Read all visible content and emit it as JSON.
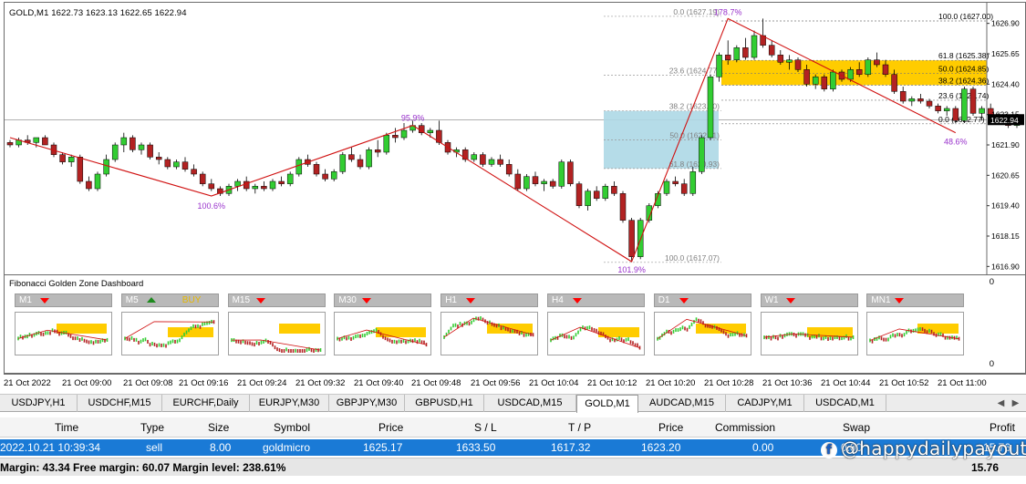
{
  "chart": {
    "title": "GOLD,M1  1622.73 1623.13 1622.65 1622.94",
    "price_tag": "1622.94",
    "price_axis": [
      "1626.90",
      "1625.65",
      "1624.40",
      "1623.15",
      "1621.90",
      "1620.65",
      "1619.40",
      "1618.15",
      "1616.90"
    ],
    "zigzag_labels": [
      "100.6%",
      "95.9%",
      "101.9%",
      "178.7%",
      "48.6%"
    ],
    "fib_left": [
      "0.0 (1627.19)",
      "23.6 (1624.77)",
      "38.2 (1623.30)",
      "50.0 (1622.11)",
      "61.8 (1620.93)",
      "100.0 (1617.07)"
    ],
    "fib_right": [
      "100.0 (1627.00)",
      "61.8 (1625.38)",
      "50.0 (1624.85)",
      "38.2 (1624.36)",
      "23.6 (1623.74)",
      "0.0 (1622.77)"
    ],
    "candles": [
      [
        1622.0,
        1622.1,
        1621.8,
        1621.9
      ],
      [
        1621.9,
        1622.2,
        1621.8,
        1622.1
      ],
      [
        1622.1,
        1622.3,
        1621.9,
        1622.0
      ],
      [
        1622.0,
        1622.2,
        1621.8,
        1622.2
      ],
      [
        1622.2,
        1622.3,
        1621.9,
        1621.9
      ],
      [
        1621.9,
        1622.0,
        1621.4,
        1621.5
      ],
      [
        1621.5,
        1621.6,
        1621.1,
        1621.2
      ],
      [
        1621.2,
        1621.5,
        1621.0,
        1621.4
      ],
      [
        1621.4,
        1621.5,
        1620.3,
        1620.4
      ],
      [
        1620.4,
        1620.6,
        1620.0,
        1620.1
      ],
      [
        1620.1,
        1620.8,
        1620.0,
        1620.7
      ],
      [
        1620.7,
        1621.5,
        1620.6,
        1621.3
      ],
      [
        1621.3,
        1622.0,
        1621.2,
        1621.9
      ],
      [
        1621.9,
        1622.4,
        1621.6,
        1622.2
      ],
      [
        1622.2,
        1622.3,
        1621.6,
        1621.7
      ],
      [
        1621.7,
        1622.0,
        1621.5,
        1621.9
      ],
      [
        1621.9,
        1622.0,
        1621.3,
        1621.4
      ],
      [
        1621.4,
        1621.6,
        1621.1,
        1621.3
      ],
      [
        1621.3,
        1621.4,
        1620.9,
        1621.0
      ],
      [
        1621.0,
        1621.3,
        1620.9,
        1621.2
      ],
      [
        1621.2,
        1621.4,
        1620.8,
        1620.9
      ],
      [
        1620.9,
        1621.1,
        1620.6,
        1620.7
      ],
      [
        1620.7,
        1620.8,
        1620.2,
        1620.3
      ],
      [
        1620.3,
        1620.5,
        1620.0,
        1620.1
      ],
      [
        1620.1,
        1620.2,
        1619.8,
        1619.9
      ],
      [
        1619.9,
        1620.3,
        1619.8,
        1620.2
      ],
      [
        1620.2,
        1620.5,
        1620.0,
        1620.4
      ],
      [
        1620.4,
        1620.6,
        1620.0,
        1620.1
      ],
      [
        1620.1,
        1620.3,
        1619.9,
        1620.2
      ],
      [
        1620.2,
        1620.4,
        1620.0,
        1620.1
      ],
      [
        1620.1,
        1620.5,
        1620.0,
        1620.4
      ],
      [
        1620.4,
        1620.6,
        1620.2,
        1620.3
      ],
      [
        1620.3,
        1620.8,
        1620.2,
        1620.7
      ],
      [
        1620.7,
        1621.4,
        1620.6,
        1621.3
      ],
      [
        1621.3,
        1621.5,
        1621.0,
        1621.1
      ],
      [
        1621.1,
        1621.2,
        1620.6,
        1620.7
      ],
      [
        1620.7,
        1620.9,
        1620.4,
        1620.5
      ],
      [
        1620.5,
        1620.9,
        1620.4,
        1620.8
      ],
      [
        1620.8,
        1621.6,
        1620.7,
        1621.5
      ],
      [
        1621.5,
        1621.8,
        1621.2,
        1621.3
      ],
      [
        1621.3,
        1621.5,
        1620.9,
        1621.0
      ],
      [
        1621.0,
        1621.8,
        1620.9,
        1621.7
      ],
      [
        1621.7,
        1622.1,
        1621.4,
        1621.6
      ],
      [
        1621.6,
        1622.4,
        1621.5,
        1622.3
      ],
      [
        1622.3,
        1622.6,
        1622.0,
        1622.2
      ],
      [
        1622.2,
        1622.8,
        1622.1,
        1622.5
      ],
      [
        1622.5,
        1622.9,
        1622.4,
        1622.7
      ],
      [
        1622.7,
        1622.8,
        1622.3,
        1622.4
      ],
      [
        1622.4,
        1622.6,
        1622.2,
        1622.5
      ],
      [
        1622.5,
        1622.9,
        1621.9,
        1622.0
      ],
      [
        1622.0,
        1622.1,
        1621.5,
        1621.6
      ],
      [
        1621.6,
        1621.8,
        1621.4,
        1621.7
      ],
      [
        1621.7,
        1621.8,
        1621.2,
        1621.3
      ],
      [
        1621.3,
        1621.6,
        1621.2,
        1621.5
      ],
      [
        1621.5,
        1621.6,
        1621.0,
        1621.1
      ],
      [
        1621.1,
        1621.4,
        1621.0,
        1621.3
      ],
      [
        1621.3,
        1621.5,
        1621.0,
        1621.1
      ],
      [
        1621.1,
        1621.3,
        1620.6,
        1620.7
      ],
      [
        1620.7,
        1620.9,
        1620.0,
        1620.1
      ],
      [
        1620.1,
        1620.7,
        1620.0,
        1620.6
      ],
      [
        1620.6,
        1620.8,
        1620.2,
        1620.3
      ],
      [
        1620.3,
        1620.5,
        1620.0,
        1620.4
      ],
      [
        1620.4,
        1620.5,
        1620.1,
        1620.2
      ],
      [
        1620.2,
        1621.3,
        1620.1,
        1621.2
      ],
      [
        1621.2,
        1621.3,
        1620.2,
        1620.3
      ],
      [
        1620.3,
        1620.4,
        1619.3,
        1619.4
      ],
      [
        1619.4,
        1620.1,
        1619.2,
        1620.0
      ],
      [
        1620.0,
        1620.2,
        1619.6,
        1619.7
      ],
      [
        1619.7,
        1620.3,
        1619.6,
        1620.2
      ],
      [
        1620.2,
        1620.4,
        1619.8,
        1619.9
      ],
      [
        1619.9,
        1620.0,
        1618.7,
        1618.8
      ],
      [
        1618.8,
        1618.9,
        1617.1,
        1617.3
      ],
      [
        1617.3,
        1618.9,
        1617.2,
        1618.8
      ],
      [
        1618.8,
        1619.5,
        1618.7,
        1619.4
      ],
      [
        1619.4,
        1620.0,
        1619.3,
        1619.9
      ],
      [
        1619.9,
        1620.5,
        1619.8,
        1620.4
      ],
      [
        1620.4,
        1620.6,
        1620.2,
        1620.3
      ],
      [
        1620.3,
        1620.5,
        1619.8,
        1619.9
      ],
      [
        1619.9,
        1621.0,
        1619.8,
        1620.8
      ],
      [
        1620.8,
        1622.3,
        1620.7,
        1622.2
      ],
      [
        1622.2,
        1624.8,
        1622.1,
        1624.7
      ],
      [
        1624.7,
        1625.7,
        1624.5,
        1625.6
      ],
      [
        1625.6,
        1626.2,
        1625.2,
        1625.4
      ],
      [
        1625.4,
        1626.0,
        1625.3,
        1625.9
      ],
      [
        1625.9,
        1626.3,
        1625.4,
        1625.5
      ],
      [
        1625.5,
        1626.6,
        1625.4,
        1626.4
      ],
      [
        1626.4,
        1627.1,
        1625.9,
        1626.0
      ],
      [
        1626.0,
        1626.2,
        1625.5,
        1625.6
      ],
      [
        1625.6,
        1625.8,
        1625.2,
        1625.3
      ],
      [
        1625.3,
        1625.6,
        1625.0,
        1625.4
      ],
      [
        1625.4,
        1625.5,
        1624.9,
        1625.0
      ],
      [
        1625.0,
        1625.2,
        1624.3,
        1624.4
      ],
      [
        1624.4,
        1624.8,
        1624.2,
        1624.7
      ],
      [
        1624.7,
        1624.8,
        1624.1,
        1624.2
      ],
      [
        1624.2,
        1625.0,
        1624.1,
        1624.9
      ],
      [
        1624.9,
        1625.0,
        1624.5,
        1624.6
      ],
      [
        1624.6,
        1625.1,
        1624.5,
        1625.0
      ],
      [
        1625.0,
        1625.3,
        1624.7,
        1624.8
      ],
      [
        1624.8,
        1625.5,
        1624.7,
        1625.4
      ],
      [
        1625.4,
        1625.7,
        1625.1,
        1625.2
      ],
      [
        1625.2,
        1625.4,
        1624.7,
        1624.8
      ],
      [
        1624.8,
        1625.0,
        1624.0,
        1624.1
      ],
      [
        1624.1,
        1624.3,
        1623.6,
        1623.7
      ],
      [
        1623.7,
        1623.9,
        1623.5,
        1623.8
      ],
      [
        1623.8,
        1624.0,
        1623.6,
        1623.7
      ],
      [
        1623.7,
        1623.8,
        1623.4,
        1623.5
      ],
      [
        1623.5,
        1623.6,
        1623.2,
        1623.3
      ],
      [
        1623.3,
        1623.5,
        1623.1,
        1623.4
      ],
      [
        1623.4,
        1623.5,
        1622.8,
        1622.9
      ],
      [
        1622.9,
        1624.3,
        1622.8,
        1624.2
      ],
      [
        1624.2,
        1624.3,
        1623.1,
        1623.2
      ],
      [
        1623.2,
        1623.5,
        1622.9,
        1623.4
      ],
      [
        1623.4,
        1623.6,
        1623.0,
        1623.1
      ],
      [
        1623.1,
        1623.2,
        1622.8,
        1622.9
      ],
      [
        1622.9,
        1623.0,
        1622.6,
        1622.7
      ],
      [
        1622.7,
        1623.1,
        1622.6,
        1622.9
      ]
    ]
  },
  "dashboard": {
    "title": "Fibonacci Golden Zone Dashboard",
    "scale_top": "0",
    "scale_bottom": "0",
    "timeframes": [
      {
        "label": "M1",
        "direction": "down",
        "signal": ""
      },
      {
        "label": "M5",
        "direction": "up",
        "signal": "BUY"
      },
      {
        "label": "M15",
        "direction": "down",
        "signal": ""
      },
      {
        "label": "M30",
        "direction": "down",
        "signal": ""
      },
      {
        "label": "H1",
        "direction": "down",
        "signal": ""
      },
      {
        "label": "H4",
        "direction": "down",
        "signal": ""
      },
      {
        "label": "D1",
        "direction": "down",
        "signal": ""
      },
      {
        "label": "W1",
        "direction": "down",
        "signal": ""
      },
      {
        "label": "MN1",
        "direction": "down",
        "signal": ""
      }
    ]
  },
  "time_axis": [
    "21 Oct 2022",
    "21 Oct 09:00",
    "21 Oct 09:08",
    "21 Oct 09:16",
    "21 Oct 09:24",
    "21 Oct 09:32",
    "21 Oct 09:40",
    "21 Oct 09:48",
    "21 Oct 09:56",
    "21 Oct 10:04",
    "21 Oct 10:12",
    "21 Oct 10:20",
    "21 Oct 10:28",
    "21 Oct 10:36",
    "21 Oct 10:44",
    "21 Oct 10:52",
    "21 Oct 11:00"
  ],
  "tabs": [
    "USDJPY,H1",
    "USDCHF,M15",
    "EURCHF,Daily",
    "EURJPY,M30",
    "GBPJPY,M30",
    "GBPUSD,H1",
    "USDCAD,M15",
    "GOLD,M1",
    "AUDCAD,M15",
    "CADJPY,M1",
    "USDCAD,M1"
  ],
  "active_tab": "GOLD,M1",
  "table": {
    "headers": {
      "time": "Time",
      "type": "Type",
      "size": "Size",
      "symbol": "Symbol",
      "price": "Price",
      "sl": "S / L",
      "tp": "T / P",
      "price2": "Price",
      "commission": "Commission",
      "swap": "Swap",
      "profit": "Profit"
    },
    "row": {
      "time": "2022.10.21 10:39:34",
      "type": "sell",
      "size": "8.00",
      "symbol": "goldmicro",
      "price": "1625.17",
      "sl": "1633.50",
      "tp": "1617.32",
      "price2": "1623.20",
      "commission": "0.00",
      "swap": "0.00",
      "profit": "15.76"
    },
    "summary": "Margin: 43.34   Free margin: 60.07   Margin level: 238.61%",
    "summary_profit": "15.76"
  },
  "watermark": "@happydailypayouts",
  "colors": {
    "bull": "#32cd32",
    "bear": "#b22222",
    "zigzag": "#d01010",
    "golden_zone": "#ffcc00",
    "blue_zone": "#add8e6",
    "fib_label": "#808080",
    "zz_label": "#9932cc",
    "selected_row": "#1a7ad6"
  }
}
